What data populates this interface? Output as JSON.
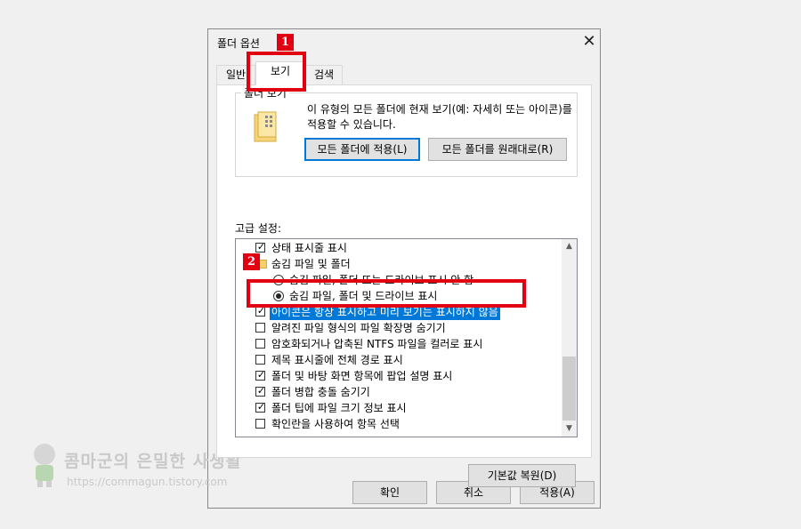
{
  "dialog": {
    "title": "폴더 옵션",
    "close_glyph": "✕",
    "tabs": [
      {
        "label": "일반"
      },
      {
        "label": "보기"
      },
      {
        "label": "검색"
      }
    ],
    "active_tab": "보기"
  },
  "folder_views": {
    "legend": "폴더 보기",
    "description": "이 유형의 모든 폴더에 현재 보기(예: 자세히 또는 아이콘)를 적용할 수 있습니다.",
    "apply_button": "모든 폴더에 적용(L)",
    "reset_button": "모든 폴더를 원래대로(R)"
  },
  "advanced": {
    "label": "고급 설정:",
    "items": [
      {
        "type": "checkbox",
        "checked": true,
        "label": "상태 표시줄 표시"
      },
      {
        "type": "folder",
        "label": "숨김 파일 및 폴더"
      },
      {
        "type": "radio",
        "checked": false,
        "label": "숨김 파일, 폴더 또는 드라이브 표시 안 함"
      },
      {
        "type": "radio",
        "checked": true,
        "label": "숨김 파일, 폴더 및 드라이브 표시"
      },
      {
        "type": "checkbox",
        "checked": true,
        "label": "아이콘은 항상 표시하고 미리 보기는 표시하지 않음",
        "selected": true
      },
      {
        "type": "checkbox",
        "checked": false,
        "label": "알려진 파일 형식의 파일 확장명 숨기기"
      },
      {
        "type": "checkbox",
        "checked": false,
        "label": "암호화되거나 압축된 NTFS 파일을 컬러로 표시"
      },
      {
        "type": "checkbox",
        "checked": false,
        "label": "제목 표시줄에 전체 경로 표시"
      },
      {
        "type": "checkbox",
        "checked": true,
        "label": "폴더 및 바탕 화면 항목에 팝업 설명 표시"
      },
      {
        "type": "checkbox",
        "checked": true,
        "label": "폴더 병합 충돌 숨기기"
      },
      {
        "type": "checkbox",
        "checked": true,
        "label": "폴더 팁에 파일 크기 정보 표시"
      },
      {
        "type": "checkbox",
        "checked": false,
        "label": "확인란을 사용하여 항목 선택"
      }
    ],
    "restore_button": "기본값 복원(D)"
  },
  "footer": {
    "ok": "확인",
    "cancel": "취소",
    "apply": "적용(A)"
  },
  "annotations": {
    "badge1": "1",
    "badge2": "2",
    "color": "#e00012"
  },
  "watermark": {
    "title": "콤마군의 은밀한 사생활",
    "url": "https://commagun.tistory.com"
  }
}
